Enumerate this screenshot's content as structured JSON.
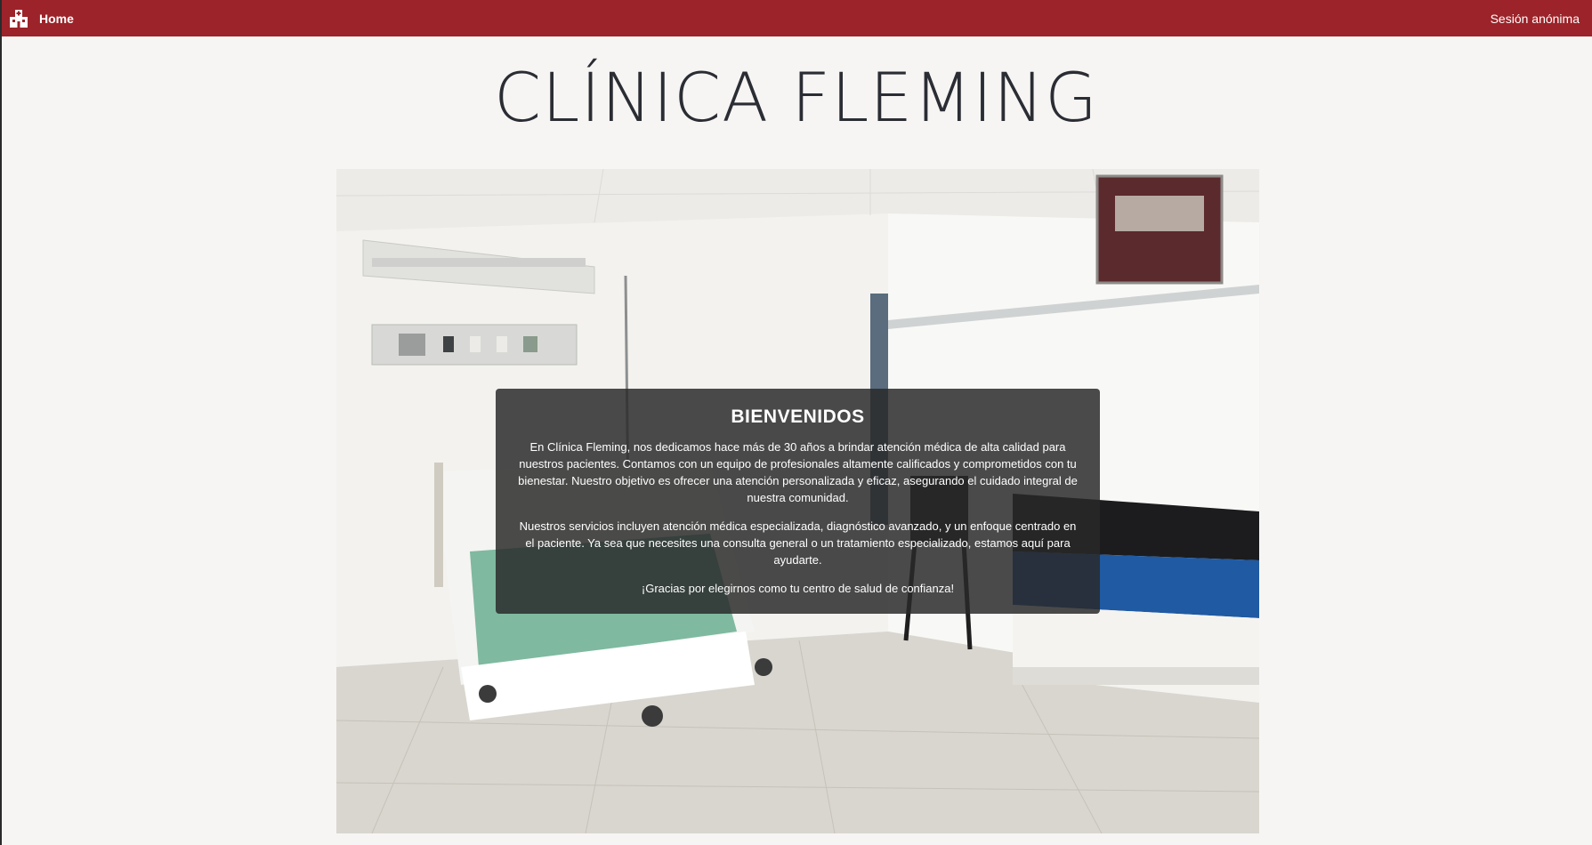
{
  "navbar": {
    "home_icon": "hospital-icon",
    "home_label": "Home",
    "session_label": "Sesión anónima",
    "color": "#9c2329"
  },
  "page": {
    "title": "CLÍNICA FLEMING"
  },
  "hero": {
    "image": "hospital-room-photo"
  },
  "welcome": {
    "heading": "BIENVENIDOS",
    "paragraph1": "En Clínica Fleming, nos dedicamos hace más de 30 años a brindar atención médica de alta calidad para nuestros pacientes. Contamos con un equipo de profesionales altamente calificados y comprometidos con tu bienestar. Nuestro objetivo es ofrecer una atención personalizada y eficaz, asegurando el cuidado integral de nuestra comunidad.",
    "paragraph2": "Nuestros servicios incluyen atención médica especializada, diagnóstico avanzado, y un enfoque centrado en el paciente. Ya sea que necesites una consulta general o un tratamiento especializado, estamos aquí para ayudarte.",
    "paragraph3": "¡Gracias por elegirnos como tu centro de salud de confianza!"
  }
}
